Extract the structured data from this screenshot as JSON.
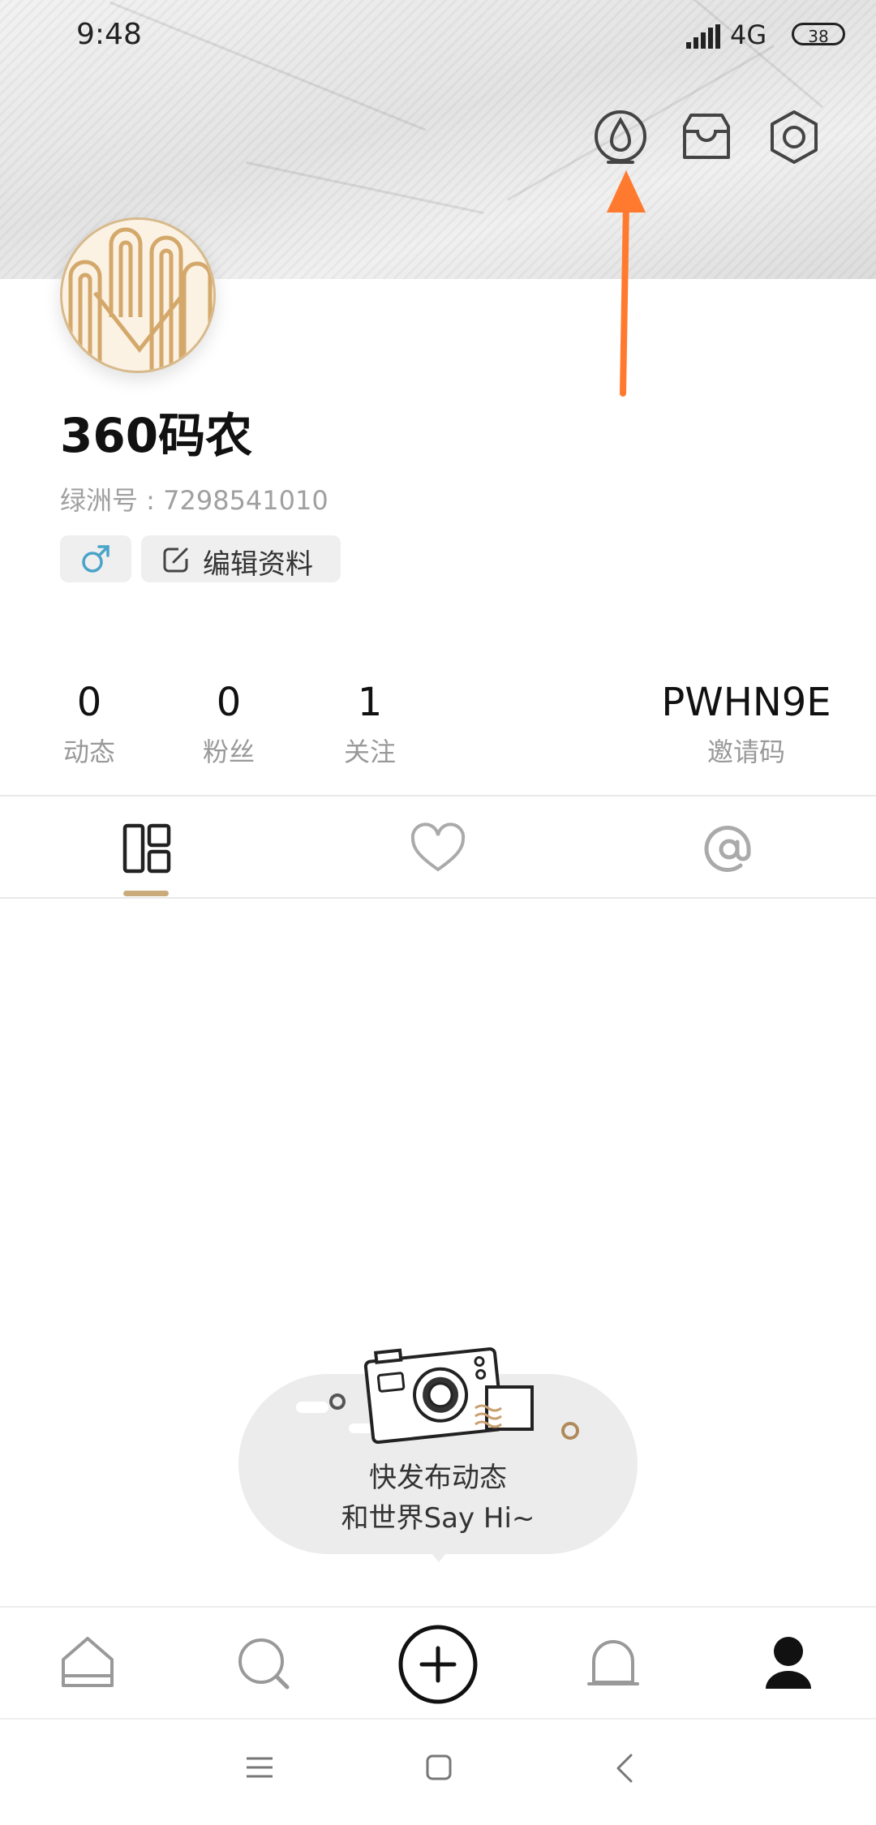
{
  "status_bar": {
    "time": "9:48",
    "network": "4G",
    "battery": "38"
  },
  "header": {
    "icons": [
      "droplet-icon",
      "inbox-icon",
      "settings-icon"
    ]
  },
  "profile": {
    "name": "360码农",
    "id_label": "绿洲号 : 7298541010",
    "gender": "male",
    "edit_label": "编辑资料"
  },
  "stats": [
    {
      "value": "0",
      "label": "动态"
    },
    {
      "value": "0",
      "label": "粉丝"
    },
    {
      "value": "1",
      "label": "关注"
    }
  ],
  "invite": {
    "code": "PWHN9E",
    "label": "邀请码"
  },
  "tabs": [
    "posts-grid-icon",
    "heart-icon",
    "at-icon"
  ],
  "empty_state": {
    "line1": "快发布动态",
    "line2": "和世界Say Hi~"
  },
  "bottom_nav": [
    "home-icon",
    "search-icon",
    "add-icon",
    "bell-icon",
    "profile-icon"
  ],
  "colors": {
    "accent": "#c9ab7c",
    "male": "#4aa3c8",
    "arrow": "#ff7a2e"
  }
}
